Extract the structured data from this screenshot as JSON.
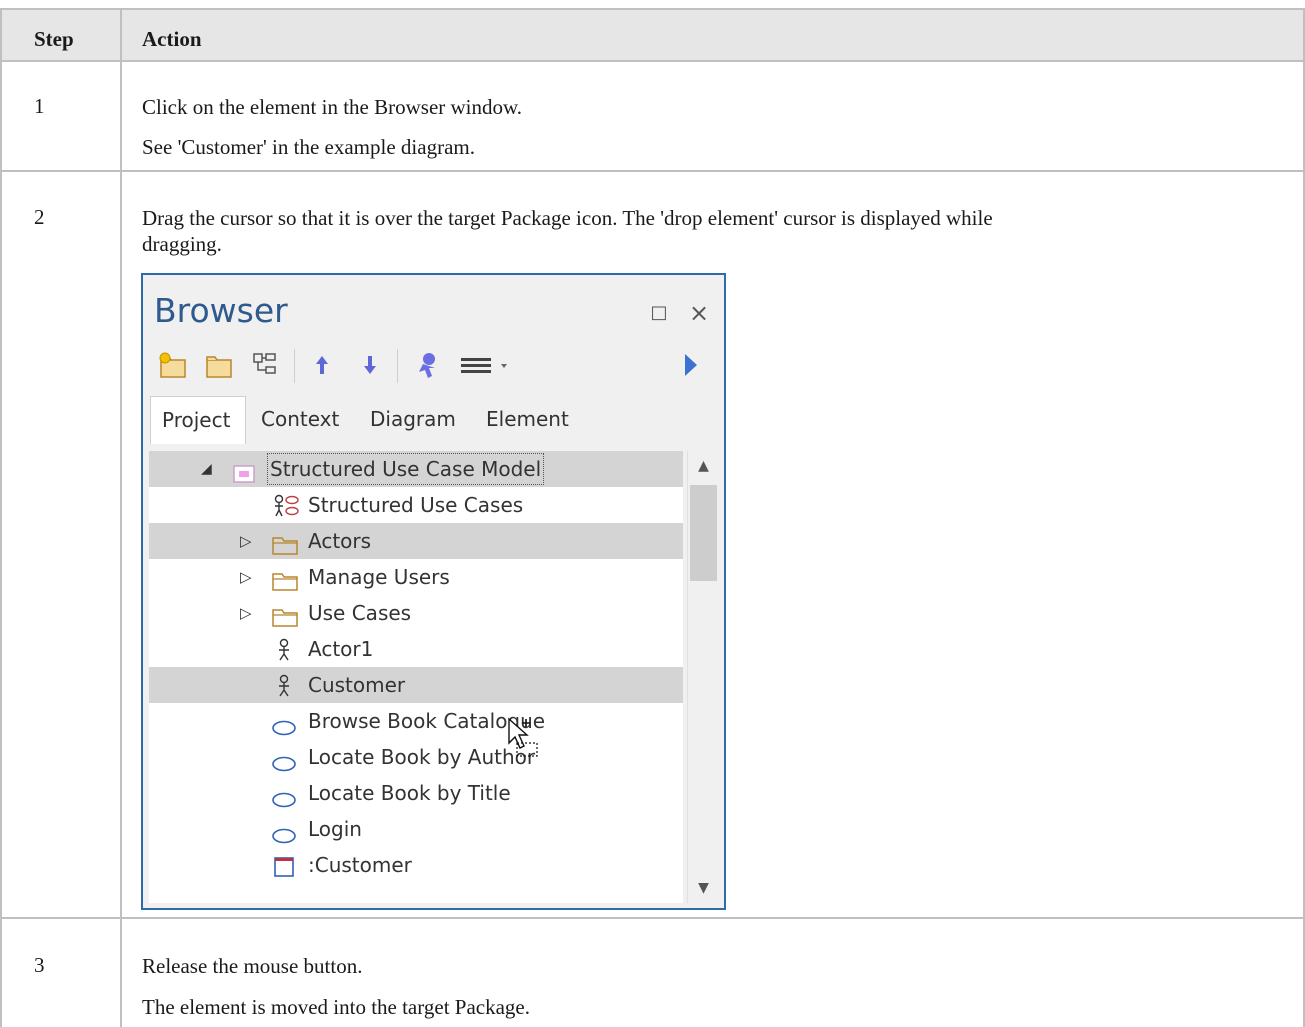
{
  "table": {
    "headers": {
      "step": "Step",
      "action": "Action"
    },
    "rows": [
      {
        "step": "1",
        "lines": [
          "Click on the element in the Browser window.",
          "See 'Customer' in the example diagram."
        ]
      },
      {
        "step": "2",
        "lines": [
          "Drag the cursor so that it is over the target Package icon.  The 'drop element' cursor is displayed while",
          "dragging."
        ]
      },
      {
        "step": "3",
        "lines": [
          "Release the mouse button.",
          "The element is moved into the target Package."
        ]
      }
    ]
  },
  "browser": {
    "title": "Browser",
    "window_buttons": {
      "maximize": "□",
      "close": "×"
    },
    "toolbar": [
      "new-package-icon",
      "folder-icon",
      "hierarchy-icon",
      "move-up-icon",
      "move-down-icon",
      "locate-icon",
      "menu-icon",
      "play-icon"
    ],
    "tabs": [
      {
        "label": "Project",
        "active": true
      },
      {
        "label": "Context",
        "active": false
      },
      {
        "label": "Diagram",
        "active": false
      },
      {
        "label": "Element",
        "active": false
      }
    ],
    "tree": [
      {
        "label": "Structured Use Case Model",
        "icon": "package-model-icon",
        "expander": "◢",
        "selected": true
      },
      {
        "label": "Structured Use Cases",
        "icon": "usecase-diagram-icon",
        "expander": "",
        "selected": false
      },
      {
        "label": "Actors",
        "icon": "folder-icon",
        "expander": "▷",
        "selected": true
      },
      {
        "label": "Manage Users",
        "icon": "folder-icon",
        "expander": "▷",
        "selected": false
      },
      {
        "label": "Use Cases",
        "icon": "folder-icon",
        "expander": "▷",
        "selected": false
      },
      {
        "label": "Actor1",
        "icon": "actor-icon",
        "expander": "",
        "selected": false
      },
      {
        "label": "Customer",
        "icon": "actor-icon",
        "expander": "",
        "selected": true
      },
      {
        "label": "Browse Book Catalogue",
        "icon": "usecase-icon",
        "expander": "",
        "selected": false
      },
      {
        "label": "Locate Book by Author",
        "icon": "usecase-icon",
        "expander": "",
        "selected": false
      },
      {
        "label": "Locate Book by Title",
        "icon": "usecase-icon",
        "expander": "",
        "selected": false
      },
      {
        "label": "Login",
        "icon": "usecase-icon",
        "expander": "",
        "selected": false
      },
      {
        "label": ":Customer",
        "icon": "instance-icon",
        "expander": "",
        "selected": false
      }
    ],
    "scroll": {
      "up": "▲",
      "down": "▼"
    }
  },
  "colors": {
    "title": "#2e5a8e",
    "border": "#2e6ba8",
    "header_bg": "#e6e6e6",
    "selection": "#d4d4d4"
  }
}
